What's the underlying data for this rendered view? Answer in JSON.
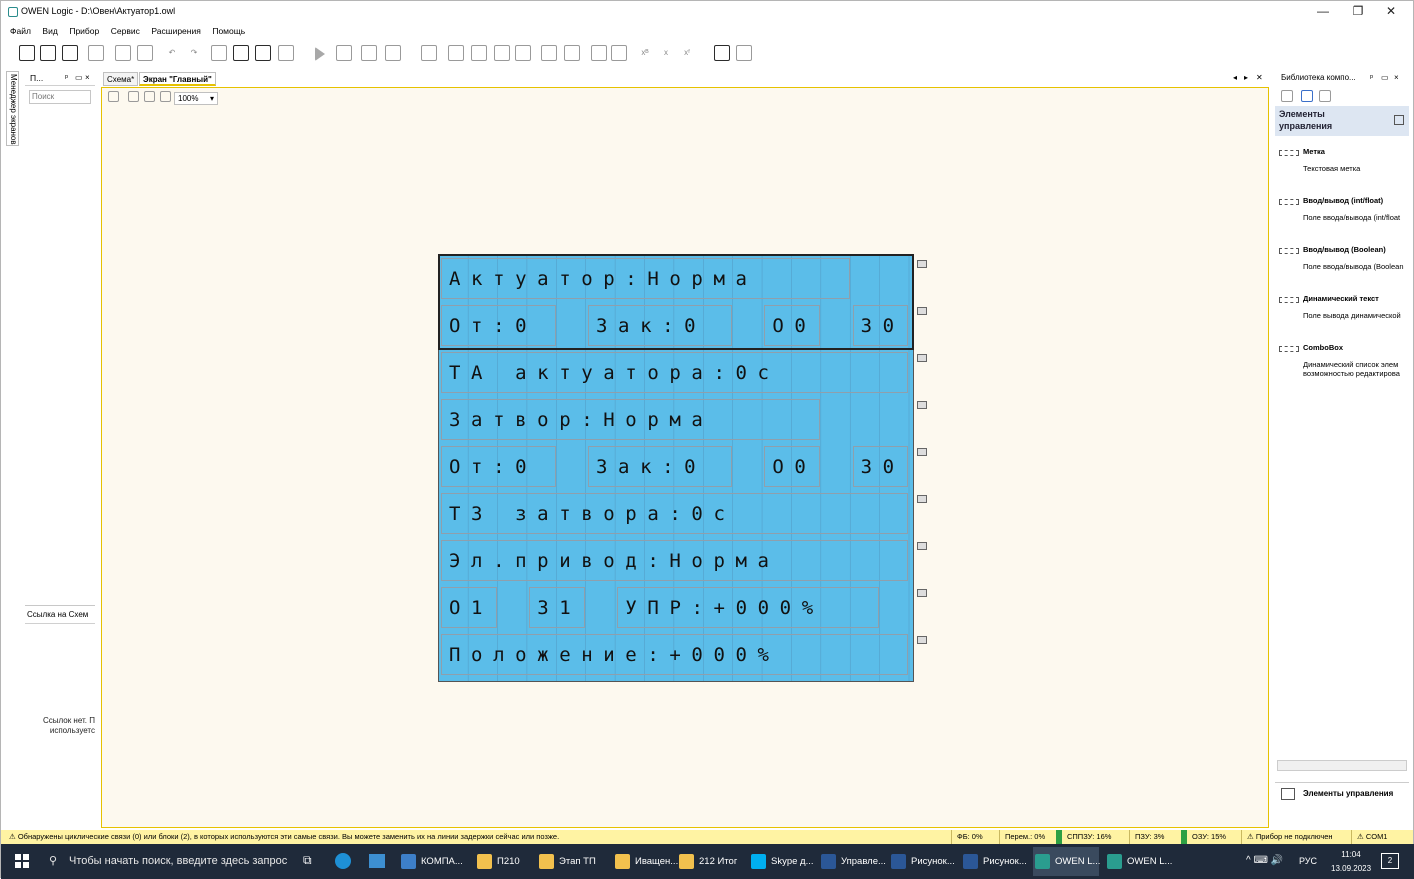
{
  "window": {
    "title": "OWEN Logic - D:\\Овен\\Актуатор1.owl",
    "min": "—",
    "max": "❐",
    "close": "✕"
  },
  "menu": [
    "Файл",
    "Вид",
    "Прибор",
    "Сервис",
    "Расширения",
    "Помощь"
  ],
  "left_panel": {
    "tab_label": "Менеджер экранов",
    "title": "П...",
    "pin": "ᵖ",
    "float": "▭",
    "close": "×",
    "search_placeholder": "Поиск",
    "refs_title": "Ссылка на Схем",
    "refs_msg": "Ссылок нет. П используетс"
  },
  "tabs": [
    {
      "label": "Схема*"
    },
    {
      "label": "Экран \"Главный\""
    }
  ],
  "tab_controls": {
    "left": "◂",
    "right": "▸",
    "close": "✕"
  },
  "editor": {
    "zoom": "100%"
  },
  "screen": {
    "rows": [
      [
        {
          "text": "Актуатор:Норма",
          "c": 0,
          "w": 14
        }
      ],
      [
        {
          "text": "От:0",
          "c": 0,
          "w": 4
        },
        {
          "text": "Зак:0",
          "c": 5,
          "w": 5
        },
        {
          "text": "О0",
          "c": 11,
          "w": 2
        },
        {
          "text": "30",
          "c": 14,
          "w": 2
        }
      ],
      [
        {
          "text": "ТА актуатора:0с",
          "c": 0,
          "w": 16
        }
      ],
      [
        {
          "text": "Затвор:Норма",
          "c": 0,
          "w": 13
        }
      ],
      [
        {
          "text": "От:0",
          "c": 0,
          "w": 4
        },
        {
          "text": "Зак:0",
          "c": 5,
          "w": 5
        },
        {
          "text": "О0",
          "c": 11,
          "w": 2
        },
        {
          "text": "30",
          "c": 14,
          "w": 2
        }
      ],
      [
        {
          "text": "ТЗ затвора:0с",
          "c": 0,
          "w": 16
        }
      ],
      [
        {
          "text": "Эл.привод:Норма",
          "c": 0,
          "w": 16
        }
      ],
      [
        {
          "text": "О1",
          "c": 0,
          "w": 2
        },
        {
          "text": "31",
          "c": 3,
          "w": 2
        },
        {
          "text": "УПР:+000%",
          "c": 6,
          "w": 9
        }
      ],
      [
        {
          "text": "Положение:+000%",
          "c": 0,
          "w": 16
        }
      ]
    ]
  },
  "right_panel": {
    "title": "Библиотека компо...",
    "pin": "ᵖ",
    "float": "▭",
    "close": "×",
    "category": "Элементы управления",
    "components": [
      {
        "name": "Метка",
        "desc": "Текстовая метка"
      },
      {
        "name": "Ввод/вывод (int/float)",
        "desc": "Поле ввода/вывода (int/float"
      },
      {
        "name": "Ввод/вывод (Boolean)",
        "desc": "Поле ввода/вывода (Boolean"
      },
      {
        "name": "Динамический текст",
        "desc": "Поле вывода динамической"
      },
      {
        "name": "ComboBox",
        "desc": "Динамический список элем возможностью редактирова"
      }
    ],
    "footer": "Элементы управления"
  },
  "status": {
    "message": "Обнаружены циклические связи (0) или блоки (2), в которых используются эти самые связи. Вы можете заменить их на линии задержки сейчас или позже.",
    "fb": "ФБ: 0%",
    "perem": "Перем.: 0%",
    "spzu": "СППЗУ: 16%",
    "pzu": "ПЗУ: 3%",
    "ozu": "ОЗУ: 15%",
    "device": "Прибор не подключен",
    "port": "COM1"
  },
  "taskbar": {
    "search_placeholder": "Чтобы начать поиск, введите здесь запрос",
    "apps": [
      {
        "label": "КОМПА...",
        "color": "#3d7fc9"
      },
      {
        "label": "П210",
        "color": "#f2c14e"
      },
      {
        "label": "Этап ТП",
        "color": "#f2c14e"
      },
      {
        "label": "Иващен...",
        "color": "#f2c14e"
      },
      {
        "label": "212 Итог",
        "color": "#f2c14e"
      },
      {
        "label": "Skype д...",
        "color": "#00aff0"
      },
      {
        "label": "Управле...",
        "color": "#2b5797"
      },
      {
        "label": "Рисунок...",
        "color": "#2b5797"
      },
      {
        "label": "Рисунок...",
        "color": "#2b5797"
      },
      {
        "label": "OWEN L...",
        "color": "#2a9d8f"
      },
      {
        "label": "OWEN L...",
        "color": "#2a9d8f"
      }
    ],
    "lang": "РУС",
    "time": "11:04",
    "date": "13.09.2023",
    "notif": "2"
  },
  "colors": {
    "lcd": "#5bbde9",
    "canvas": "#fdf9ef",
    "statusbar": "#fff3a3",
    "accent": "#e6c200"
  }
}
